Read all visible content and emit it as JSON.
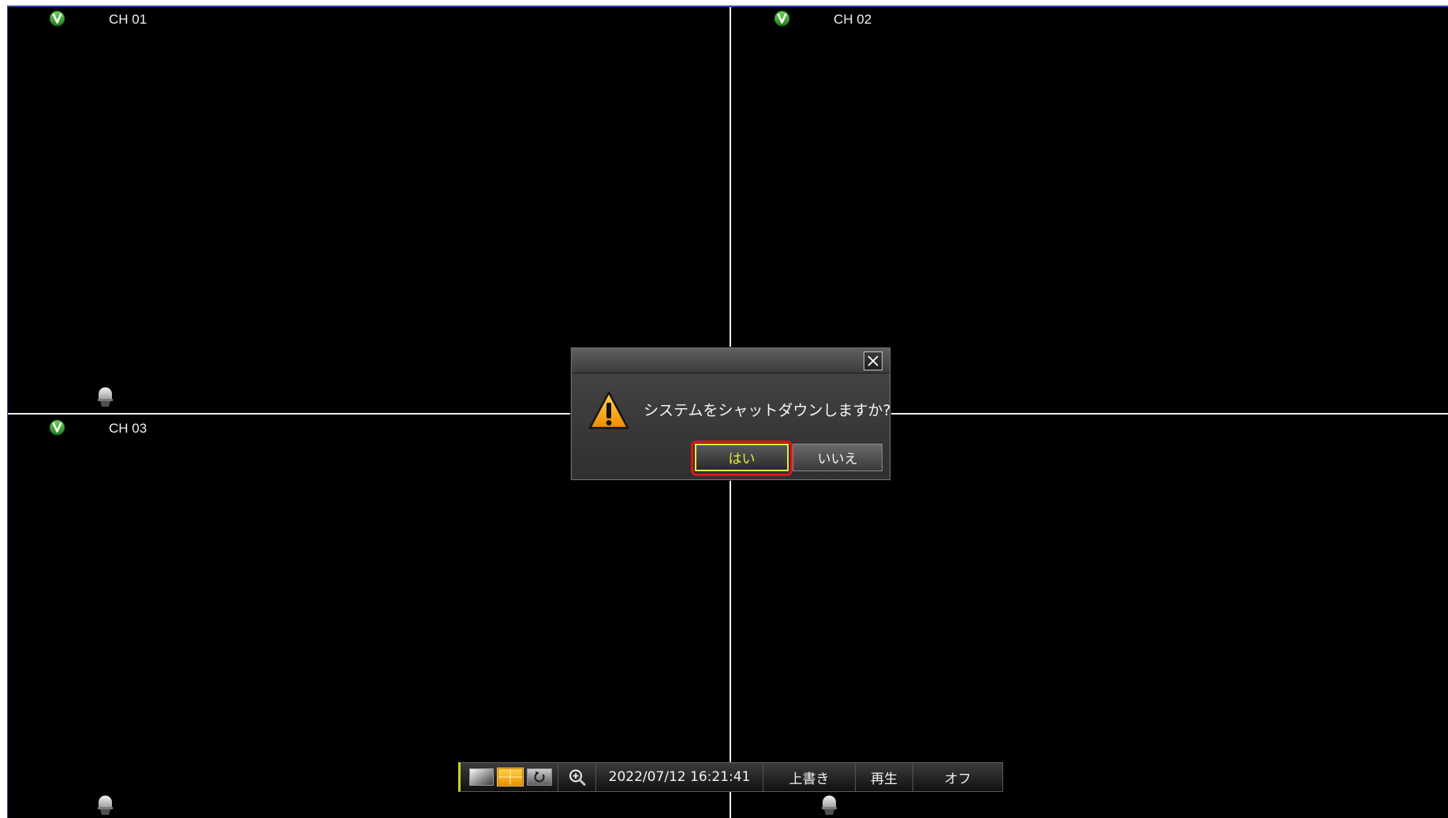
{
  "colors": {
    "page_background": "#ffffff",
    "screen_background": "#000000",
    "screen_border": "#3444a6",
    "divider": "#f0f0f0",
    "highlight_frame": "#e0141c",
    "focus_yellow": "#e4ec3c",
    "toolbar_accent": "#c8d22a",
    "quad_layout_orange": "#f0a400"
  },
  "channels": [
    {
      "label": "CH 01",
      "status_icon": "v-status-icon",
      "camera_icon": "camera-dome-icon"
    },
    {
      "label": "CH 02",
      "status_icon": "v-status-icon"
    },
    {
      "label": "CH 03",
      "status_icon": "v-status-icon",
      "camera_icon": "camera-dome-icon"
    },
    {
      "camera_icon": "camera-dome-icon"
    }
  ],
  "dialog": {
    "close_icon": "close-icon",
    "warning_icon": "warning-icon",
    "message": "システムをシャットダウンしますか?",
    "yes_button": {
      "label": "はい",
      "focused": true
    },
    "no_button": {
      "label": "いいえ",
      "focused": false
    }
  },
  "toolbar": {
    "layout_buttons": [
      {
        "icon": "single-view-icon",
        "active": false
      },
      {
        "icon": "quad-view-icon",
        "active": true
      },
      {
        "icon": "sequence-rotate-icon",
        "active": false
      }
    ],
    "zoom_icon": "zoom-in-icon",
    "datetime": "2022/07/12 16:21:41",
    "overwrite_label": "上書き",
    "playback_label": "再生",
    "off_label": "オフ"
  }
}
